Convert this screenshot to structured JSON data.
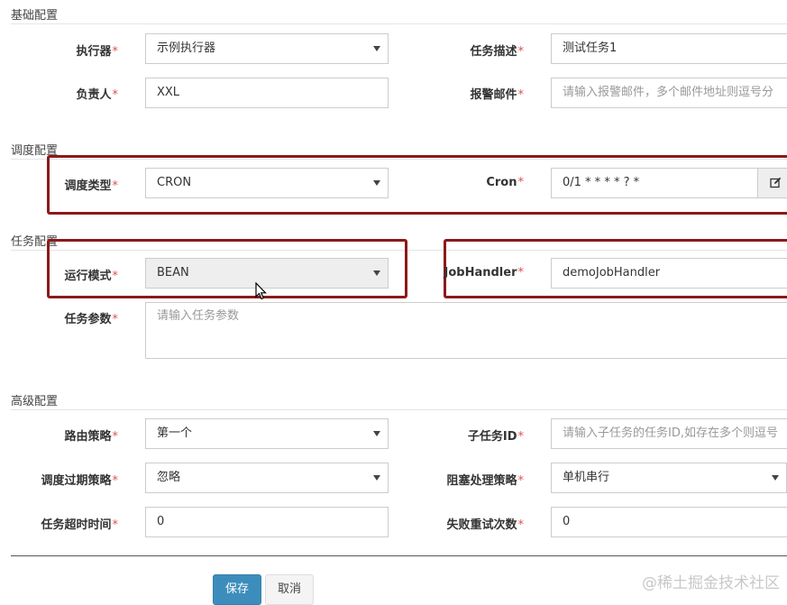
{
  "sections": {
    "basic": "基础配置",
    "schedule": "调度配置",
    "task": "任务配置",
    "advanced": "高级配置"
  },
  "required_mark": "*",
  "fields": {
    "executor": {
      "label": "执行器",
      "value": "示例执行器"
    },
    "job_desc": {
      "label": "任务描述",
      "value": "测试任务1"
    },
    "author": {
      "label": "负责人",
      "value": "XXL"
    },
    "alarm_email": {
      "label": "报警邮件",
      "placeholder": "请输入报警邮件，多个邮件地址则逗号分"
    },
    "schedule_type": {
      "label": "调度类型",
      "value": "CRON"
    },
    "cron": {
      "label": "Cron",
      "value": "0/1 * * * * ? *"
    },
    "run_mode": {
      "label": "运行模式",
      "value": "BEAN"
    },
    "job_handler": {
      "label": "JobHandler",
      "value": "demoJobHandler"
    },
    "job_param": {
      "label": "任务参数",
      "placeholder": "请输入任务参数"
    },
    "route_strategy": {
      "label": "路由策略",
      "value": "第一个"
    },
    "child_job_id": {
      "label": "子任务ID",
      "placeholder": "请输入子任务的任务ID,如存在多个则逗号"
    },
    "misfire_strategy": {
      "label": "调度过期策略",
      "value": "忽略"
    },
    "block_strategy": {
      "label": "阻塞处理策略",
      "value": "单机串行"
    },
    "timeout": {
      "label": "任务超时时间",
      "value": "0"
    },
    "fail_retry": {
      "label": "失败重试次数",
      "value": "0"
    }
  },
  "buttons": {
    "save": "保存",
    "cancel": "取消"
  },
  "watermark": "@稀土掘金技术社区",
  "icons": {
    "cron_edit": "edit-icon",
    "cursor": "mouse-cursor-icon"
  },
  "colors": {
    "highlight": "#8b1a1a",
    "required": "#d9534f",
    "primary": "#3c8dbc"
  }
}
